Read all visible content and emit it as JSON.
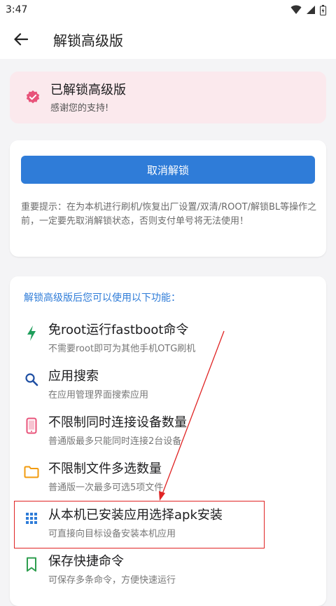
{
  "status": {
    "time": "3:47"
  },
  "appbar": {
    "title": "解锁高级版"
  },
  "unlock": {
    "title": "已解锁高级版",
    "subtitle": "感谢您的支持!"
  },
  "cancel": {
    "button_label": "取消解锁",
    "notice": "重要提示：在为本机进行刷机/恢复出厂设置/双清/ROOT/解锁BL等操作之前，一定要先取消解锁状态，否则支付单号将无法使用！"
  },
  "features": {
    "heading": "解锁高级版后您可以使用以下功能：",
    "items": [
      {
        "icon": "bolt-icon",
        "color": "#1f9e5b",
        "title": "免root运行fastboot命令",
        "desc": "不需要root即可为其他手机OTG刷机"
      },
      {
        "icon": "search-icon",
        "color": "#1f4fa3",
        "title": "应用搜索",
        "desc": "在应用管理界面搜索应用"
      },
      {
        "icon": "phone-icon",
        "color": "#e8537a",
        "title": "不限制同时连接设备数量",
        "desc": "普通版最多只能同时连接2台设备"
      },
      {
        "icon": "folder-icon",
        "color": "#f29b0f",
        "title": "不限制文件多选数量",
        "desc": "普通版一次最多可选5项文件"
      },
      {
        "icon": "grid-icon",
        "color": "#2f7cd8",
        "title": "从本机已安装应用选择apk安装",
        "desc": "可直接向目标设备安装本机应用"
      },
      {
        "icon": "bookmark-icon",
        "color": "#2e9e4f",
        "title": "保存快捷命令",
        "desc": "可保存多条命令，方便快速运行"
      }
    ]
  },
  "annotation_color": "#e02424"
}
